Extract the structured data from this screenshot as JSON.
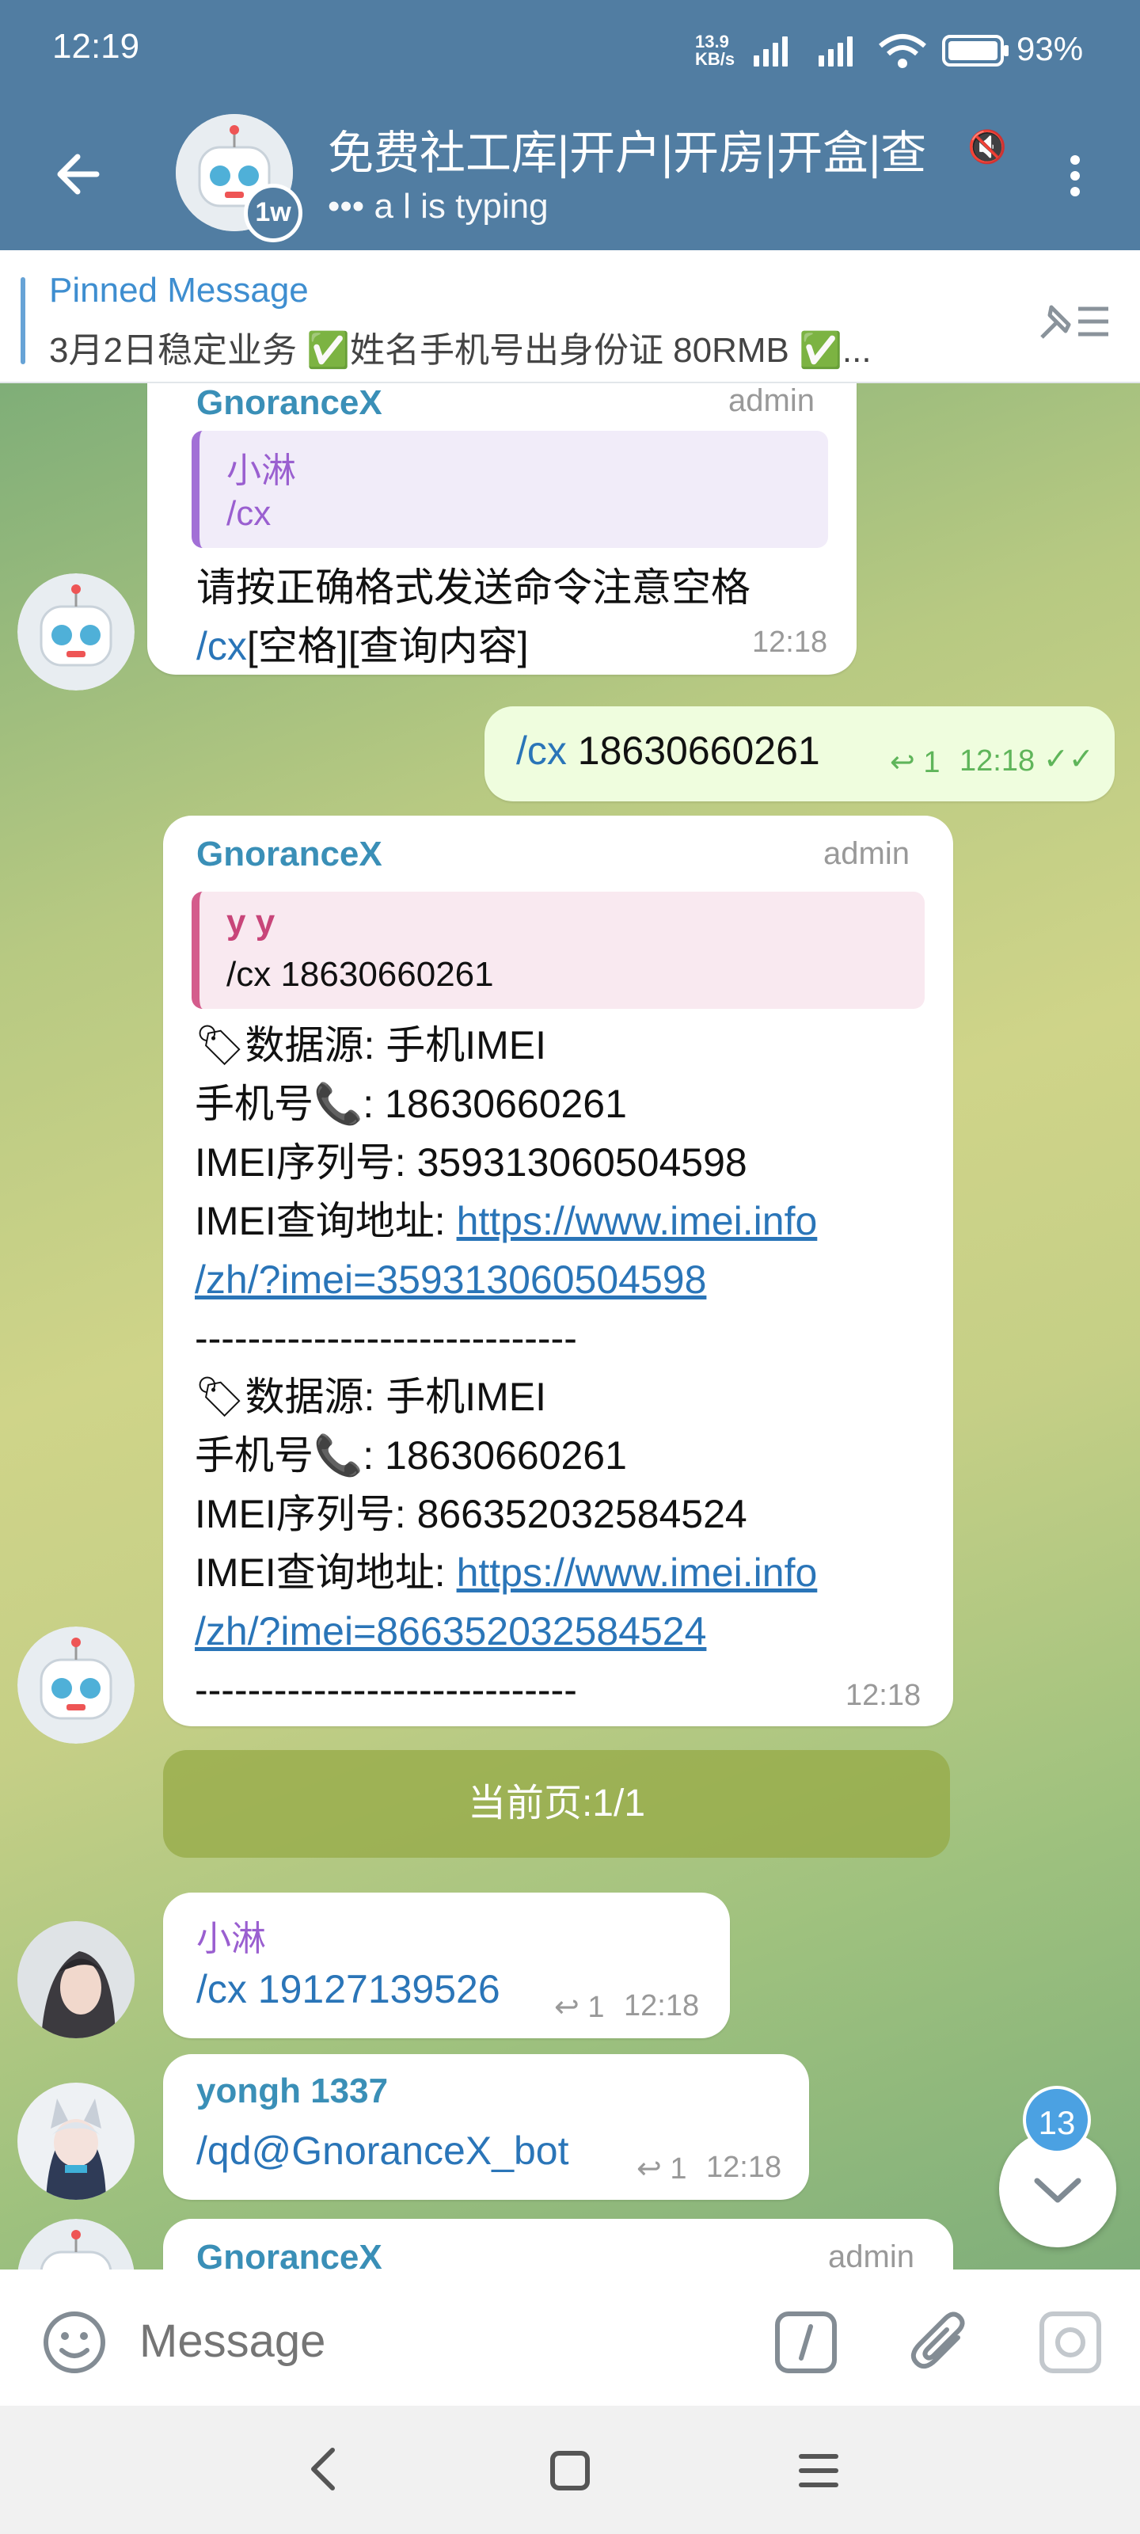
{
  "status_bar": {
    "time": "12:19",
    "net_speed_top": "13.9",
    "net_speed_bottom": "KB/s",
    "battery": "93%"
  },
  "header": {
    "title": "免费社工库|开户|开房|开盒|查",
    "subtitle": "••• a l is typing",
    "avatar_badge": "1w"
  },
  "pinned": {
    "title": "Pinned Message",
    "text": "3月2日稳定业务 ✅姓名手机号出身份证 80RMB ✅..."
  },
  "messages": {
    "m1": {
      "sender": "GnoranceX",
      "role": "admin",
      "quote_name": "小淋",
      "quote_text": "/cx",
      "line1": "请按正确格式发送命令注意空格",
      "line2_cmd": "/cx",
      "line2_rest": "[空格][查询内容]",
      "time": "12:18"
    },
    "m2": {
      "cmd": "/cx",
      "number": " 18630660261",
      "reply_count": "1",
      "time": "12:18"
    },
    "m3": {
      "sender": "GnoranceX",
      "role": "admin",
      "quote_name": "y y",
      "quote_text": "/cx 18630660261",
      "r1_source": "数据源: 手机IMEI",
      "r1_phone": "手机号📞: 18630660261",
      "r1_imei": "IMEI序列号: 359313060504598",
      "r1_query_label": "IMEI查询地址: ",
      "r1_link_a": "https://www.imei.info",
      "r1_link_b": "/zh/?imei=359313060504598",
      "divider": "-----------------------------",
      "r2_source": "数据源: 手机IMEI",
      "r2_phone": "手机号📞: 18630660261",
      "r2_imei": "IMEI序列号: 866352032584524",
      "r2_query_label": "IMEI查询地址: ",
      "r2_link_a": "https://www.imei.info",
      "r2_link_b": "/zh/?imei=866352032584524",
      "time": "12:18"
    },
    "page_button": "当前页:1/1",
    "m4": {
      "sender": "小淋",
      "text": "/cx 19127139526",
      "reply_count": "1",
      "time": "12:18"
    },
    "m5": {
      "sender": "yongh 1337",
      "text": "/qd@GnoranceX_bot",
      "reply_count": "1",
      "time": "12:18"
    },
    "m6": {
      "sender": "GnoranceX",
      "role": "admin"
    }
  },
  "unread_count": "13",
  "input": {
    "placeholder": "Message"
  },
  "icons": {
    "back": "back-arrow-icon",
    "menu": "more-vert-icon",
    "emoji": "emoji-icon",
    "command": "slash-command-icon",
    "attach": "paperclip-icon",
    "camera": "camera-icon"
  }
}
